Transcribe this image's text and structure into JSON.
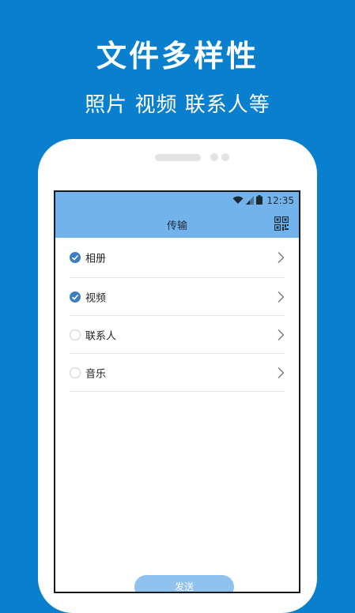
{
  "promo": {
    "headline": "文件多样性",
    "subline": "照片 视频 联系人等"
  },
  "status_bar": {
    "time": "12:35",
    "icons": [
      "wifi-icon",
      "signal-icon",
      "battery-icon"
    ]
  },
  "app_bar": {
    "title": "传输",
    "action_icon": "qr-code-icon"
  },
  "items": [
    {
      "label": "相册",
      "checked": true
    },
    {
      "label": "视频",
      "checked": true
    },
    {
      "label": "联系人",
      "checked": false
    },
    {
      "label": "音乐",
      "checked": false
    }
  ],
  "send_label": "发送",
  "colors": {
    "background": "#0a7fcd",
    "app_bar": "#72b3ec",
    "check": "#3d7ec2",
    "send_button": "#8fc2ee"
  }
}
